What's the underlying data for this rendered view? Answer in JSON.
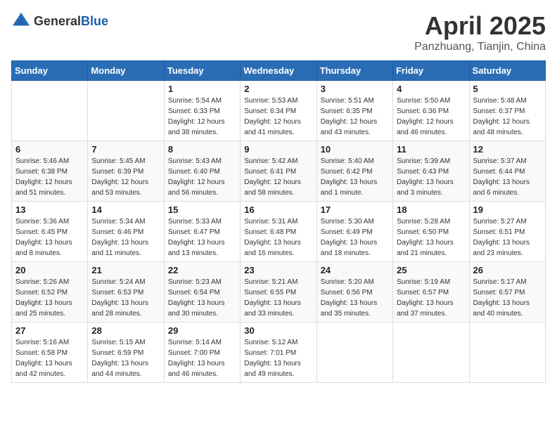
{
  "header": {
    "logo_general": "General",
    "logo_blue": "Blue",
    "month_title": "April 2025",
    "location": "Panzhuang, Tianjin, China"
  },
  "weekdays": [
    "Sunday",
    "Monday",
    "Tuesday",
    "Wednesday",
    "Thursday",
    "Friday",
    "Saturday"
  ],
  "weeks": [
    [
      {
        "day": "",
        "info": ""
      },
      {
        "day": "",
        "info": ""
      },
      {
        "day": "1",
        "info": "Sunrise: 5:54 AM\nSunset: 6:33 PM\nDaylight: 12 hours\nand 38 minutes."
      },
      {
        "day": "2",
        "info": "Sunrise: 5:53 AM\nSunset: 6:34 PM\nDaylight: 12 hours\nand 41 minutes."
      },
      {
        "day": "3",
        "info": "Sunrise: 5:51 AM\nSunset: 6:35 PM\nDaylight: 12 hours\nand 43 minutes."
      },
      {
        "day": "4",
        "info": "Sunrise: 5:50 AM\nSunset: 6:36 PM\nDaylight: 12 hours\nand 46 minutes."
      },
      {
        "day": "5",
        "info": "Sunrise: 5:48 AM\nSunset: 6:37 PM\nDaylight: 12 hours\nand 48 minutes."
      }
    ],
    [
      {
        "day": "6",
        "info": "Sunrise: 5:46 AM\nSunset: 6:38 PM\nDaylight: 12 hours\nand 51 minutes."
      },
      {
        "day": "7",
        "info": "Sunrise: 5:45 AM\nSunset: 6:39 PM\nDaylight: 12 hours\nand 53 minutes."
      },
      {
        "day": "8",
        "info": "Sunrise: 5:43 AM\nSunset: 6:40 PM\nDaylight: 12 hours\nand 56 minutes."
      },
      {
        "day": "9",
        "info": "Sunrise: 5:42 AM\nSunset: 6:41 PM\nDaylight: 12 hours\nand 58 minutes."
      },
      {
        "day": "10",
        "info": "Sunrise: 5:40 AM\nSunset: 6:42 PM\nDaylight: 13 hours\nand 1 minute."
      },
      {
        "day": "11",
        "info": "Sunrise: 5:39 AM\nSunset: 6:43 PM\nDaylight: 13 hours\nand 3 minutes."
      },
      {
        "day": "12",
        "info": "Sunrise: 5:37 AM\nSunset: 6:44 PM\nDaylight: 13 hours\nand 6 minutes."
      }
    ],
    [
      {
        "day": "13",
        "info": "Sunrise: 5:36 AM\nSunset: 6:45 PM\nDaylight: 13 hours\nand 8 minutes."
      },
      {
        "day": "14",
        "info": "Sunrise: 5:34 AM\nSunset: 6:46 PM\nDaylight: 13 hours\nand 11 minutes."
      },
      {
        "day": "15",
        "info": "Sunrise: 5:33 AM\nSunset: 6:47 PM\nDaylight: 13 hours\nand 13 minutes."
      },
      {
        "day": "16",
        "info": "Sunrise: 5:31 AM\nSunset: 6:48 PM\nDaylight: 13 hours\nand 16 minutes."
      },
      {
        "day": "17",
        "info": "Sunrise: 5:30 AM\nSunset: 6:49 PM\nDaylight: 13 hours\nand 18 minutes."
      },
      {
        "day": "18",
        "info": "Sunrise: 5:28 AM\nSunset: 6:50 PM\nDaylight: 13 hours\nand 21 minutes."
      },
      {
        "day": "19",
        "info": "Sunrise: 5:27 AM\nSunset: 6:51 PM\nDaylight: 13 hours\nand 23 minutes."
      }
    ],
    [
      {
        "day": "20",
        "info": "Sunrise: 5:26 AM\nSunset: 6:52 PM\nDaylight: 13 hours\nand 25 minutes."
      },
      {
        "day": "21",
        "info": "Sunrise: 5:24 AM\nSunset: 6:53 PM\nDaylight: 13 hours\nand 28 minutes."
      },
      {
        "day": "22",
        "info": "Sunrise: 5:23 AM\nSunset: 6:54 PM\nDaylight: 13 hours\nand 30 minutes."
      },
      {
        "day": "23",
        "info": "Sunrise: 5:21 AM\nSunset: 6:55 PM\nDaylight: 13 hours\nand 33 minutes."
      },
      {
        "day": "24",
        "info": "Sunrise: 5:20 AM\nSunset: 6:56 PM\nDaylight: 13 hours\nand 35 minutes."
      },
      {
        "day": "25",
        "info": "Sunrise: 5:19 AM\nSunset: 6:57 PM\nDaylight: 13 hours\nand 37 minutes."
      },
      {
        "day": "26",
        "info": "Sunrise: 5:17 AM\nSunset: 6:57 PM\nDaylight: 13 hours\nand 40 minutes."
      }
    ],
    [
      {
        "day": "27",
        "info": "Sunrise: 5:16 AM\nSunset: 6:58 PM\nDaylight: 13 hours\nand 42 minutes."
      },
      {
        "day": "28",
        "info": "Sunrise: 5:15 AM\nSunset: 6:59 PM\nDaylight: 13 hours\nand 44 minutes."
      },
      {
        "day": "29",
        "info": "Sunrise: 5:14 AM\nSunset: 7:00 PM\nDaylight: 13 hours\nand 46 minutes."
      },
      {
        "day": "30",
        "info": "Sunrise: 5:12 AM\nSunset: 7:01 PM\nDaylight: 13 hours\nand 49 minutes."
      },
      {
        "day": "",
        "info": ""
      },
      {
        "day": "",
        "info": ""
      },
      {
        "day": "",
        "info": ""
      }
    ]
  ]
}
